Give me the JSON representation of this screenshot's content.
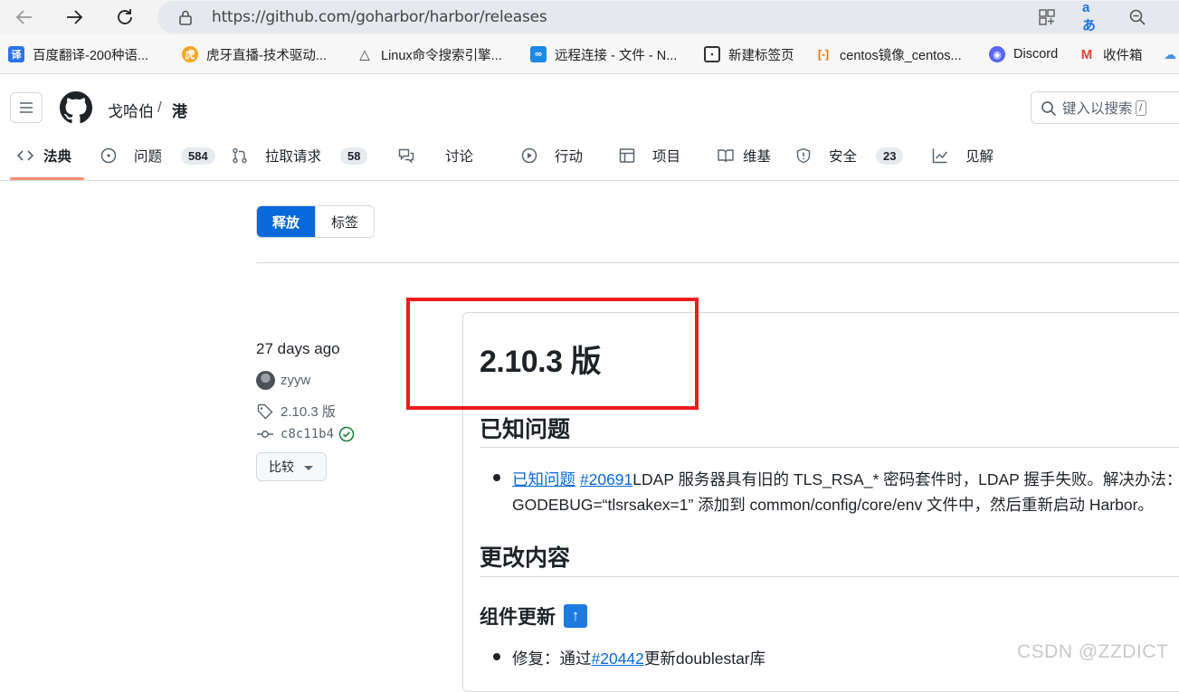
{
  "browser": {
    "url": "https://github.com/goharbor/harbor/releases",
    "bookmarks": [
      {
        "label": "百度翻译-200种语...",
        "icon": "baidu-translate-icon",
        "color": "#2b73e8",
        "glyph": "译"
      },
      {
        "label": "虎牙直播-技术驱动...",
        "icon": "huya-icon",
        "color": "#f5a623",
        "glyph": "虎"
      },
      {
        "label": "Linux命令搜索引擎...",
        "icon": "tux-icon",
        "color": "#555555",
        "glyph": "△"
      },
      {
        "label": "远程连接 - 文件 - N...",
        "icon": "remote-icon",
        "color": "#1e88e5",
        "glyph": "∞"
      },
      {
        "label": "新建标签页",
        "icon": "new-tab-icon",
        "color": "#333333",
        "glyph": "▣"
      },
      {
        "label": "centos镜像_centos...",
        "icon": "aliyun-icon",
        "color": "#ff6a00",
        "glyph": "[-]"
      },
      {
        "label": "Discord",
        "icon": "discord-icon",
        "color": "#5865f2",
        "glyph": "◉"
      },
      {
        "label": "收件箱",
        "icon": "gmail-icon",
        "color": "#ea4335",
        "glyph": "M"
      }
    ]
  },
  "header": {
    "owner": "戈哈伯",
    "separator": "/",
    "repo": "港",
    "search_placeholder": "键入以搜索",
    "search_kbd": "/"
  },
  "tabs": [
    {
      "label": "法典",
      "icon": "code-icon",
      "count": null
    },
    {
      "label": "问题",
      "icon": "issue-icon",
      "count": "584"
    },
    {
      "label": "拉取请求",
      "icon": "pull-request-icon",
      "count": "58"
    },
    {
      "label": "讨论",
      "icon": "discussion-icon",
      "count": null
    },
    {
      "label": "行动",
      "icon": "play-icon",
      "count": null
    },
    {
      "label": "项目",
      "icon": "table-icon",
      "count": null
    },
    {
      "label": "维基",
      "icon": "book-icon",
      "count": null
    },
    {
      "label": "安全",
      "icon": "shield-icon",
      "count": "23"
    },
    {
      "label": "见解",
      "icon": "graph-icon",
      "count": null
    }
  ],
  "subnav": {
    "releases": "释放",
    "tags": "标签"
  },
  "release": {
    "date": "27 days ago",
    "author": "zyyw",
    "tag": "2.10.3 版",
    "sha": "c8c11b4",
    "compare": "比较",
    "title": "2.10.3 版",
    "known_issues_heading": "已知问题",
    "known_issue_link": "已知问题",
    "known_issue_ref": "#20691",
    "known_issue_text": "LDAP 服务器具有旧的 TLS_RSA_* 密码套件时，LDAP 握手失败。解决办法：将",
    "known_issue_text2": "GODEBUG=“tlsrsakex=1” 添加到 common/config/core/env 文件中，然后重新启动 Harbor。",
    "changes_heading": "更改内容",
    "component_heading": "组件更新",
    "component_emoji": "↑",
    "fix_prefix": "修复：通过",
    "fix_ref": "#20442",
    "fix_suffix": "更新doublestar库"
  },
  "watermark": "CSDN @ZZDICT"
}
